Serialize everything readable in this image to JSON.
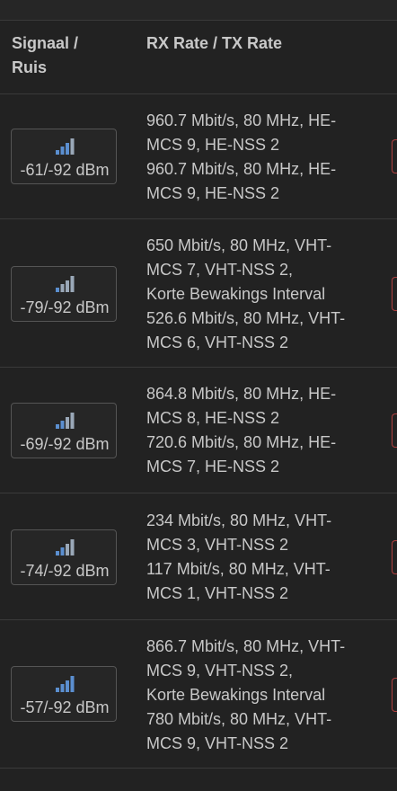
{
  "table": {
    "headers": {
      "signal_line1": "Signaal /",
      "signal_line2": "Ruis",
      "rate": "RX Rate / TX Rate"
    },
    "rows": [
      {
        "signal": "-61/-92 dBm",
        "bars_lit": 3,
        "rate_lines": [
          "960.7 Mbit/s, 80 MHz, HE-",
          "MCS 9, HE-NSS 2",
          "960.7 Mbit/s, 80 MHz, HE-",
          "MCS 9, HE-NSS 2"
        ]
      },
      {
        "signal": "-79/-92 dBm",
        "bars_lit": 1,
        "rate_lines": [
          "650 Mbit/s, 80 MHz, VHT-",
          "MCS 7, VHT-NSS 2,",
          "Korte Bewakings Interval",
          "526.6 Mbit/s, 80 MHz, VHT-",
          "MCS 6, VHT-NSS 2"
        ]
      },
      {
        "signal": "-69/-92 dBm",
        "bars_lit": 2,
        "rate_lines": [
          "864.8 Mbit/s, 80 MHz, HE-",
          "MCS 8, HE-NSS 2",
          "720.6 Mbit/s, 80 MHz, HE-",
          "MCS 7, HE-NSS 2"
        ]
      },
      {
        "signal": "-74/-92 dBm",
        "bars_lit": 2,
        "rate_lines": [
          "234 Mbit/s, 80 MHz, VHT-",
          "MCS 3, VHT-NSS 2",
          "117 Mbit/s, 80 MHz, VHT-",
          "MCS 1, VHT-NSS 2"
        ]
      },
      {
        "signal": "-57/-92 dBm",
        "bars_lit": 4,
        "rate_lines": [
          "866.7 Mbit/s, 80 MHz, VHT-",
          "MCS 9, VHT-NSS 2,",
          "Korte Bewakings Interval",
          "780 Mbit/s, 80 MHz, VHT-",
          "MCS 9, VHT-NSS 2"
        ]
      }
    ]
  },
  "colors": {
    "bar_lit": "#5b8fd0",
    "bar_dim": "#9aa8b8",
    "edge_button": "#b04040"
  },
  "icons": {
    "signal": "signal-strength-icon"
  }
}
